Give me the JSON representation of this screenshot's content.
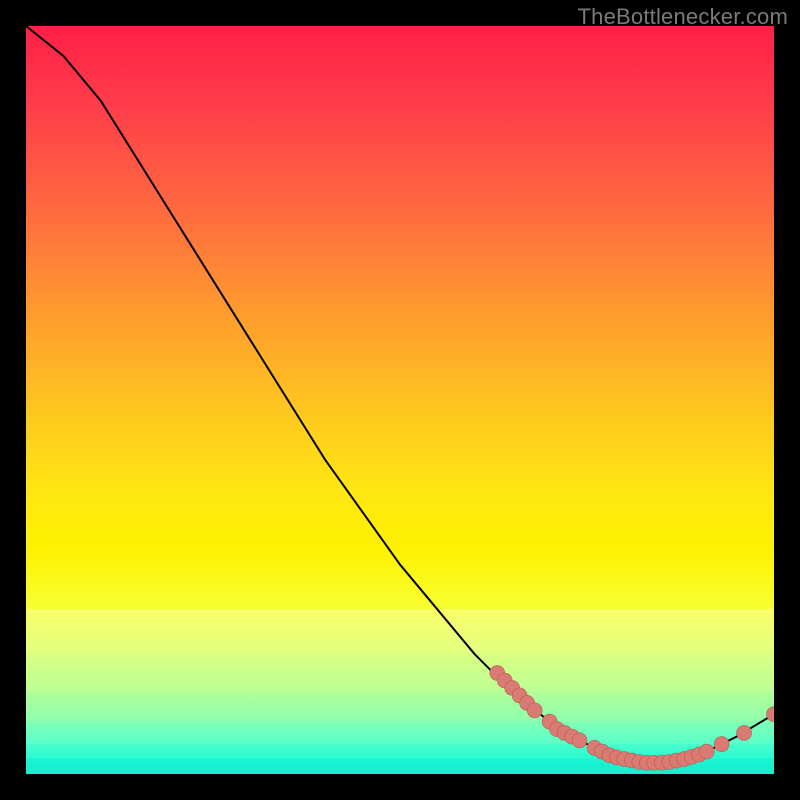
{
  "watermark": "TheBottlenecker.com",
  "colors": {
    "marker_fill": "#d97b72",
    "marker_stroke": "#b85a53",
    "curve_stroke": "#000000"
  },
  "chart_data": {
    "type": "line",
    "title": "",
    "xlabel": "",
    "ylabel": "",
    "xlim": [
      0,
      100
    ],
    "ylim": [
      0,
      100
    ],
    "note": "No axis ticks or labels are rendered in the image; values below are estimated normalized percentages read from the plot area (0,0 = bottom-left, 100,100 = top-right).",
    "curve": [
      {
        "x": 0,
        "y": 100
      },
      {
        "x": 5,
        "y": 96
      },
      {
        "x": 10,
        "y": 90
      },
      {
        "x": 15,
        "y": 82
      },
      {
        "x": 20,
        "y": 74
      },
      {
        "x": 25,
        "y": 66
      },
      {
        "x": 30,
        "y": 58
      },
      {
        "x": 35,
        "y": 50
      },
      {
        "x": 40,
        "y": 42
      },
      {
        "x": 45,
        "y": 35
      },
      {
        "x": 50,
        "y": 28
      },
      {
        "x": 55,
        "y": 22
      },
      {
        "x": 60,
        "y": 16
      },
      {
        "x": 65,
        "y": 11
      },
      {
        "x": 70,
        "y": 7
      },
      {
        "x": 75,
        "y": 4
      },
      {
        "x": 80,
        "y": 2
      },
      {
        "x": 85,
        "y": 1.5
      },
      {
        "x": 90,
        "y": 2.5
      },
      {
        "x": 95,
        "y": 5
      },
      {
        "x": 100,
        "y": 8
      }
    ],
    "markers": [
      {
        "x": 63,
        "y": 13.5
      },
      {
        "x": 64,
        "y": 12.5
      },
      {
        "x": 65,
        "y": 11.5
      },
      {
        "x": 66,
        "y": 10.5
      },
      {
        "x": 67,
        "y": 9.5
      },
      {
        "x": 68,
        "y": 8.5
      },
      {
        "x": 70,
        "y": 7
      },
      {
        "x": 71,
        "y": 6
      },
      {
        "x": 72,
        "y": 5.5
      },
      {
        "x": 73,
        "y": 5
      },
      {
        "x": 74,
        "y": 4.5
      },
      {
        "x": 76,
        "y": 3.5
      },
      {
        "x": 77,
        "y": 3
      },
      {
        "x": 78,
        "y": 2.5
      },
      {
        "x": 79,
        "y": 2.2
      },
      {
        "x": 80,
        "y": 2
      },
      {
        "x": 81,
        "y": 1.8
      },
      {
        "x": 82,
        "y": 1.6
      },
      {
        "x": 83,
        "y": 1.5
      },
      {
        "x": 84,
        "y": 1.5
      },
      {
        "x": 85,
        "y": 1.5
      },
      {
        "x": 86,
        "y": 1.6
      },
      {
        "x": 87,
        "y": 1.8
      },
      {
        "x": 88,
        "y": 2
      },
      {
        "x": 89,
        "y": 2.3
      },
      {
        "x": 90,
        "y": 2.6
      },
      {
        "x": 91,
        "y": 3
      },
      {
        "x": 93,
        "y": 4
      },
      {
        "x": 96,
        "y": 5.5
      },
      {
        "x": 100,
        "y": 8
      }
    ],
    "marker_radius_pct": 1.0
  }
}
